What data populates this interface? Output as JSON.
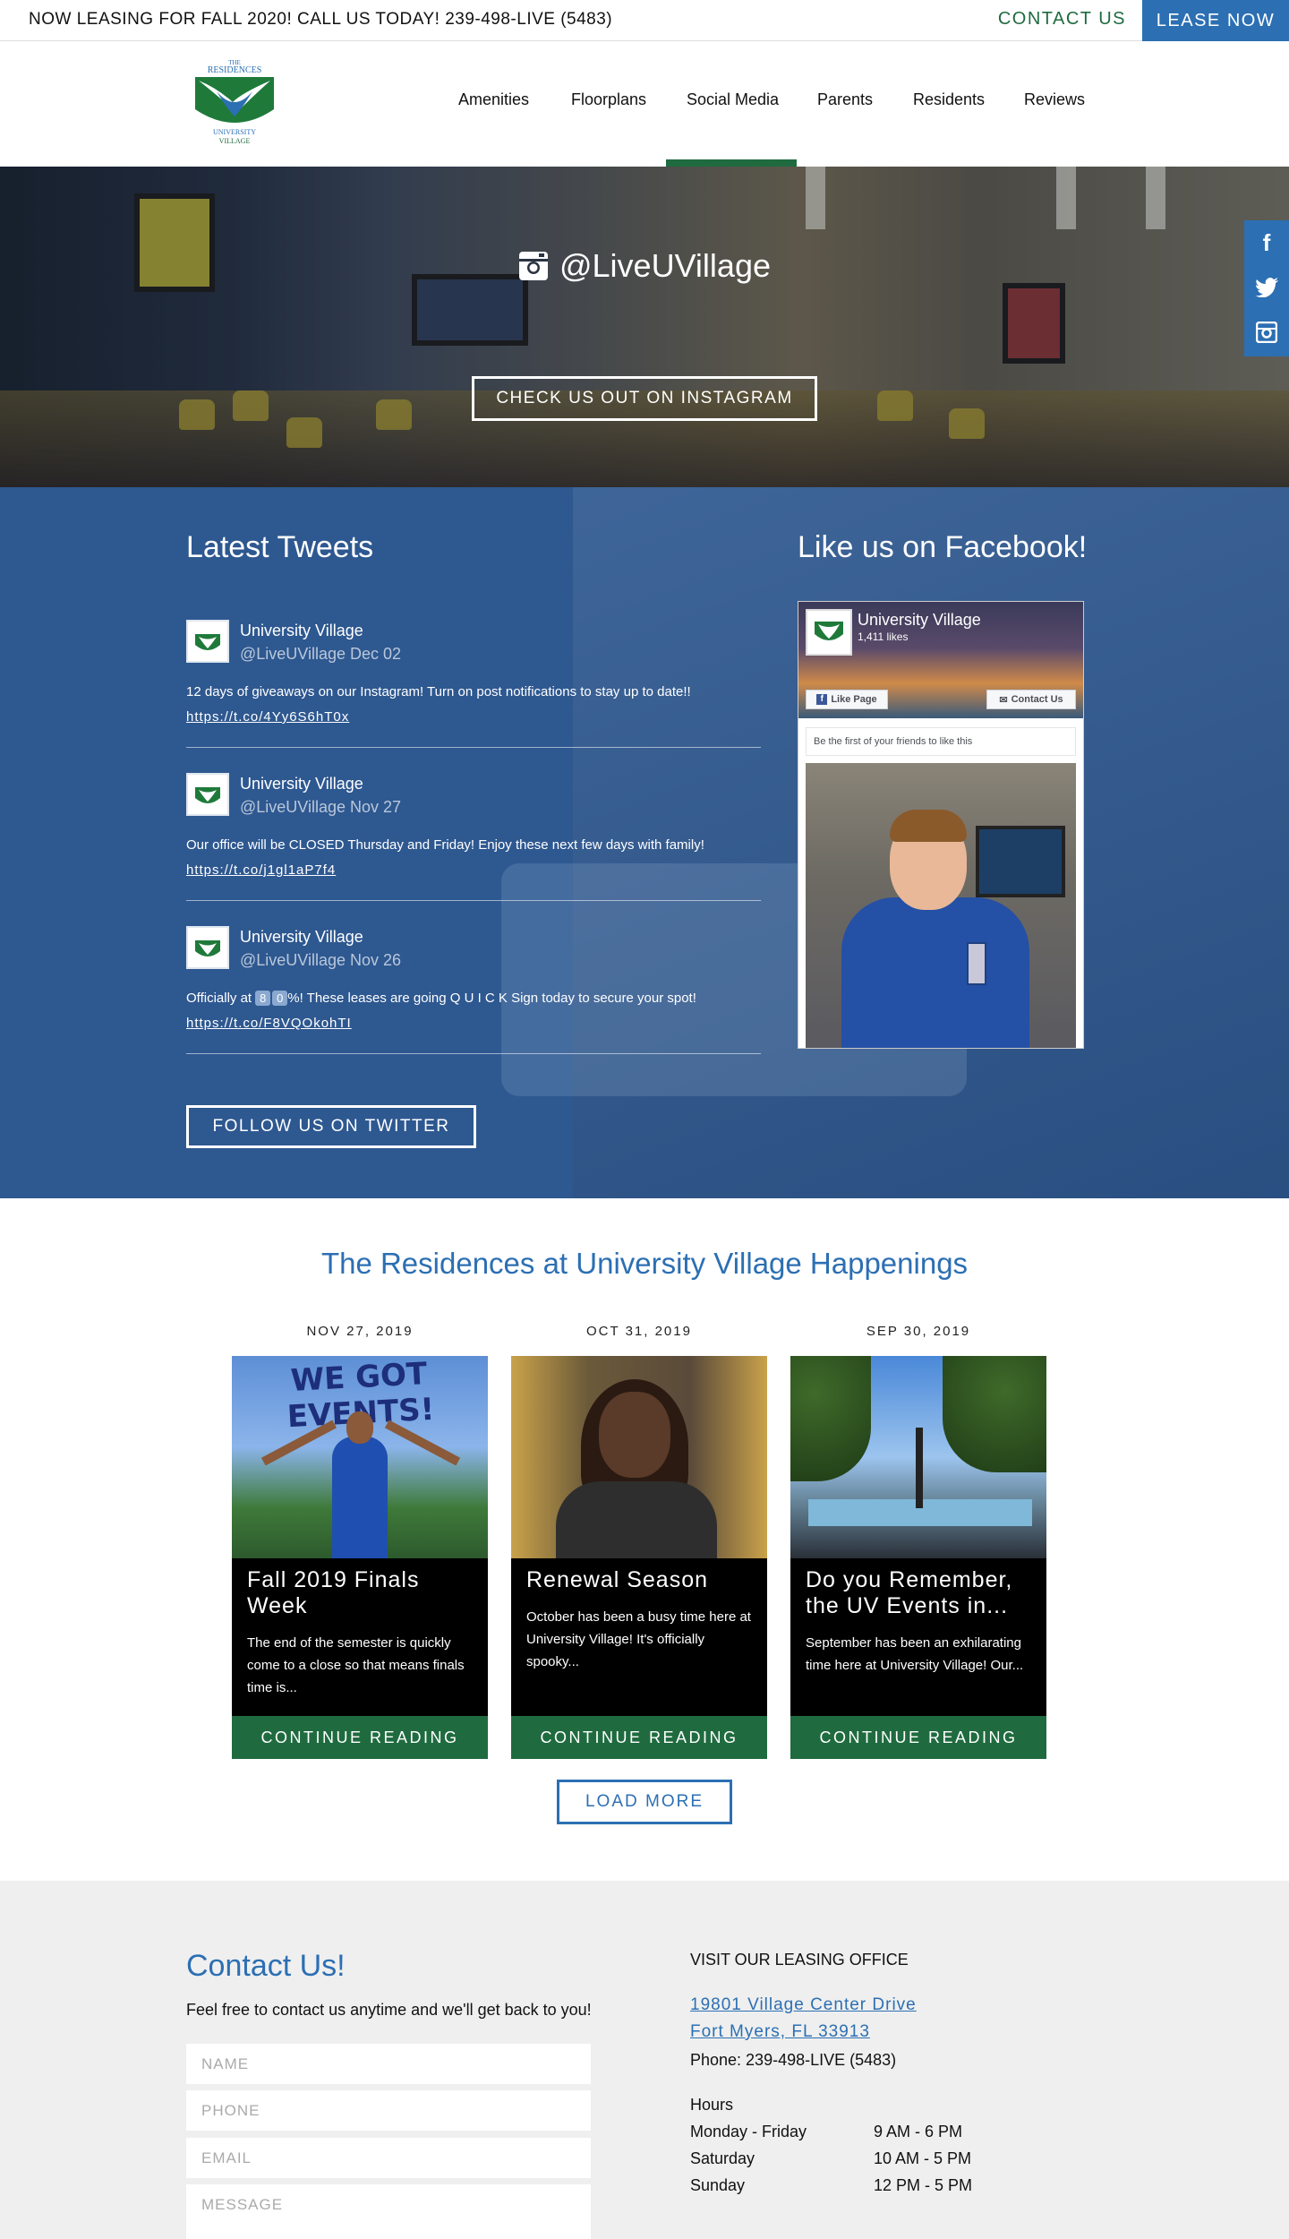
{
  "topbar": {
    "promo": "NOW LEASING FOR FALL 2020! CALL US TODAY! 239-498-LIVE (5483)",
    "contact_label": "CONTACT US",
    "lease_label": "LEASE NOW"
  },
  "logo": {
    "line1": "THE",
    "line2": "RESIDENCES",
    "line3": "UNIVERSITY",
    "line4": "VILLAGE"
  },
  "nav": {
    "items": [
      "Amenities",
      "Floorplans",
      "Social Media",
      "Parents",
      "Residents",
      "Reviews"
    ],
    "active": "Social Media"
  },
  "hero": {
    "handle": "@LiveUVillage",
    "button": "CHECK US OUT ON INSTAGRAM"
  },
  "social_rail": {
    "icons": [
      "facebook-icon",
      "twitter-icon",
      "instagram-icon"
    ]
  },
  "tweets_section": {
    "title": "Latest Tweets",
    "tweets": [
      {
        "name": "University Village",
        "handle_date": "@LiveUVillage Dec 02",
        "text": "12 days of giveaways on our Instagram! Turn on post notifications to stay up to date!!",
        "link": "https://t.co/4Yy6S6hT0x"
      },
      {
        "name": "University Village",
        "handle_date": "@LiveUVillage Nov 27",
        "text": "Our office will be CLOSED Thursday and Friday! Enjoy these next few days with family!",
        "link": "https://t.co/j1gl1aP7f4"
      },
      {
        "name": "University Village",
        "handle_date": "@LiveUVillage Nov 26",
        "text_before": "Officially at ",
        "digit1": "8",
        "digit2": "0",
        "text_after": "%! These leases are going Q U I C K Sign today to secure your spot!",
        "link": "https://t.co/F8VQOkohTI"
      }
    ],
    "follow_button": "FOLLOW US ON TWITTER"
  },
  "facebook": {
    "title": "Like us on Facebook!",
    "page_name": "University Village",
    "likes": "1,411 likes",
    "like_button": "Like Page",
    "contact_button": "Contact Us",
    "friends_text": "Be the first of your friends to like this"
  },
  "happenings": {
    "title": "The Residences at University Village Happenings",
    "posts": [
      {
        "date": "NOV 27, 2019",
        "image_text": "WE GOT EVENTS!",
        "title": "Fall 2019 Finals Week",
        "excerpt": "The end of the semester is quickly come to a close so that means finals time is...",
        "cta": "CONTINUE READING"
      },
      {
        "date": "OCT 31, 2019",
        "title": "Renewal Season",
        "excerpt": "October has been a busy time here at University Village! It's officially spooky...",
        "cta": "CONTINUE READING"
      },
      {
        "date": "SEP 30, 2019",
        "title": "Do you Remember, the UV Events in...",
        "excerpt": "September has been an exhilarating time here at University Village! Our...",
        "cta": "CONTINUE READING"
      }
    ],
    "load_more": "LOAD MORE"
  },
  "contact": {
    "title": "Contact Us!",
    "subtitle": "Feel free to contact us anytime and we'll get back to you!",
    "fields": {
      "name": "NAME",
      "phone": "PHONE",
      "email": "EMAIL",
      "message": "MESSAGE"
    },
    "visit_heading": "VISIT OUR LEASING OFFICE",
    "address_line1": "19801 Village Center Drive",
    "address_line2": "Fort Myers, FL 33913",
    "phone": "Phone: 239-498-LIVE (5483)",
    "hours_heading": "Hours",
    "hours": [
      {
        "days": "Monday - Friday",
        "time": "9 AM - 6 PM"
      },
      {
        "days": "Saturday",
        "time": "10 AM - 5 PM"
      },
      {
        "days": "Sunday",
        "time": "12 PM - 5 PM"
      }
    ]
  },
  "colors": {
    "brand_blue": "#2c6fb3",
    "brand_green": "#1f6b3f",
    "section_blue": "#2e5890",
    "contact_bg": "#efefef"
  }
}
